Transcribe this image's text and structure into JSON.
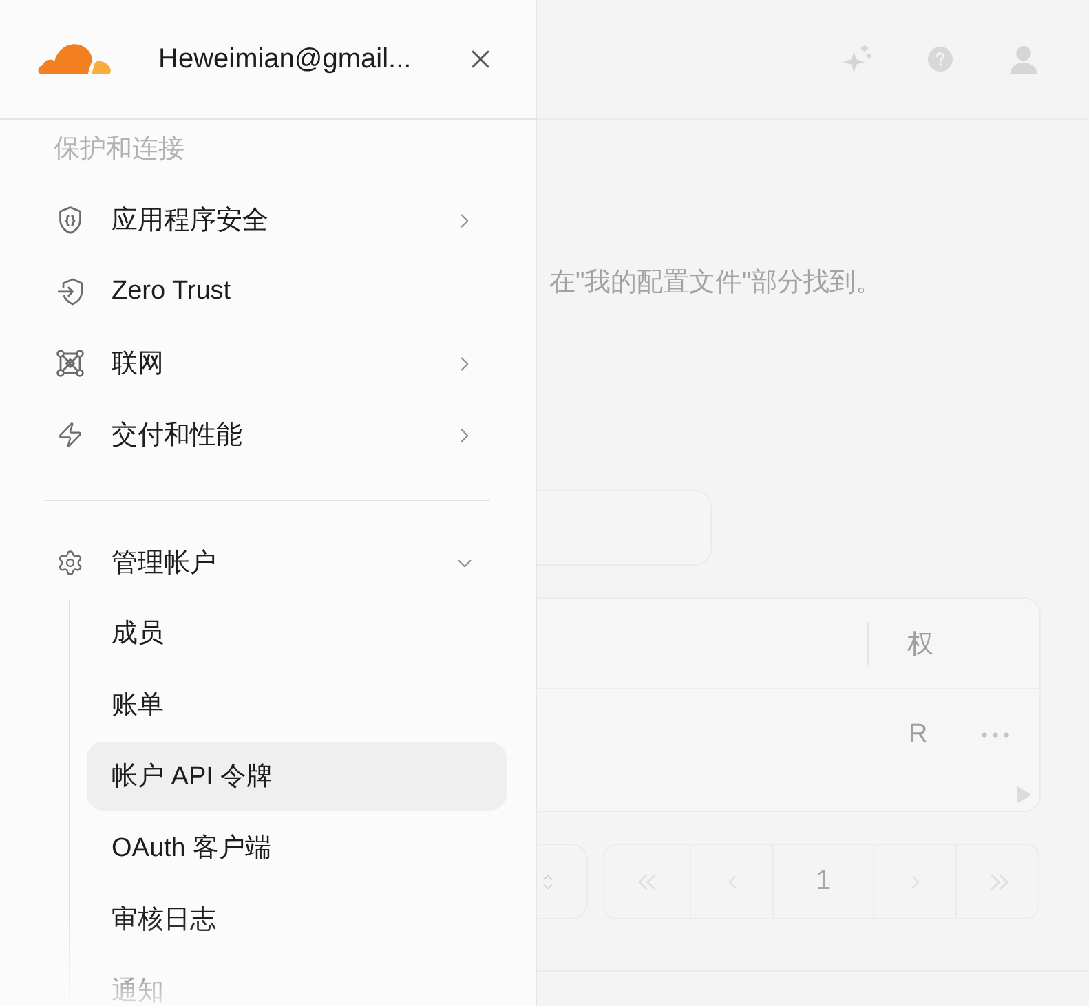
{
  "drawer": {
    "account": "Heweimian@gmail...",
    "sections": [
      {
        "title": "保护和连接",
        "items": [
          {
            "kind": "group",
            "label": "应用程序安全",
            "expanded": false
          },
          {
            "kind": "link",
            "label": "Zero Trust"
          },
          {
            "kind": "group",
            "label": "联网",
            "expanded": false
          },
          {
            "kind": "group",
            "label": "交付和性能",
            "expanded": false
          }
        ]
      },
      {
        "items": [
          {
            "kind": "group",
            "label": "管理帐户",
            "expanded": true,
            "children": [
              {
                "label": "成员",
                "selected": false
              },
              {
                "label": "账单",
                "selected": false
              },
              {
                "label": "帐户 API 令牌",
                "selected": true
              },
              {
                "label": "OAuth 客户端",
                "selected": false
              },
              {
                "label": "审核日志",
                "selected": false
              },
              {
                "label": "通知",
                "selected": false
              }
            ]
          }
        ]
      }
    ]
  },
  "page": {
    "notice": "在\"我的配置文件\"部分找到。",
    "table": {
      "columns": [
        "权"
      ],
      "rows": [
        [
          "R"
        ]
      ]
    },
    "pagination": [
      {
        "kind": "first",
        "disabled": true
      },
      {
        "kind": "prev",
        "disabled": true
      },
      {
        "kind": "page",
        "label": "1"
      },
      {
        "kind": "next",
        "disabled": true
      },
      {
        "kind": "last",
        "disabled": true
      }
    ]
  }
}
